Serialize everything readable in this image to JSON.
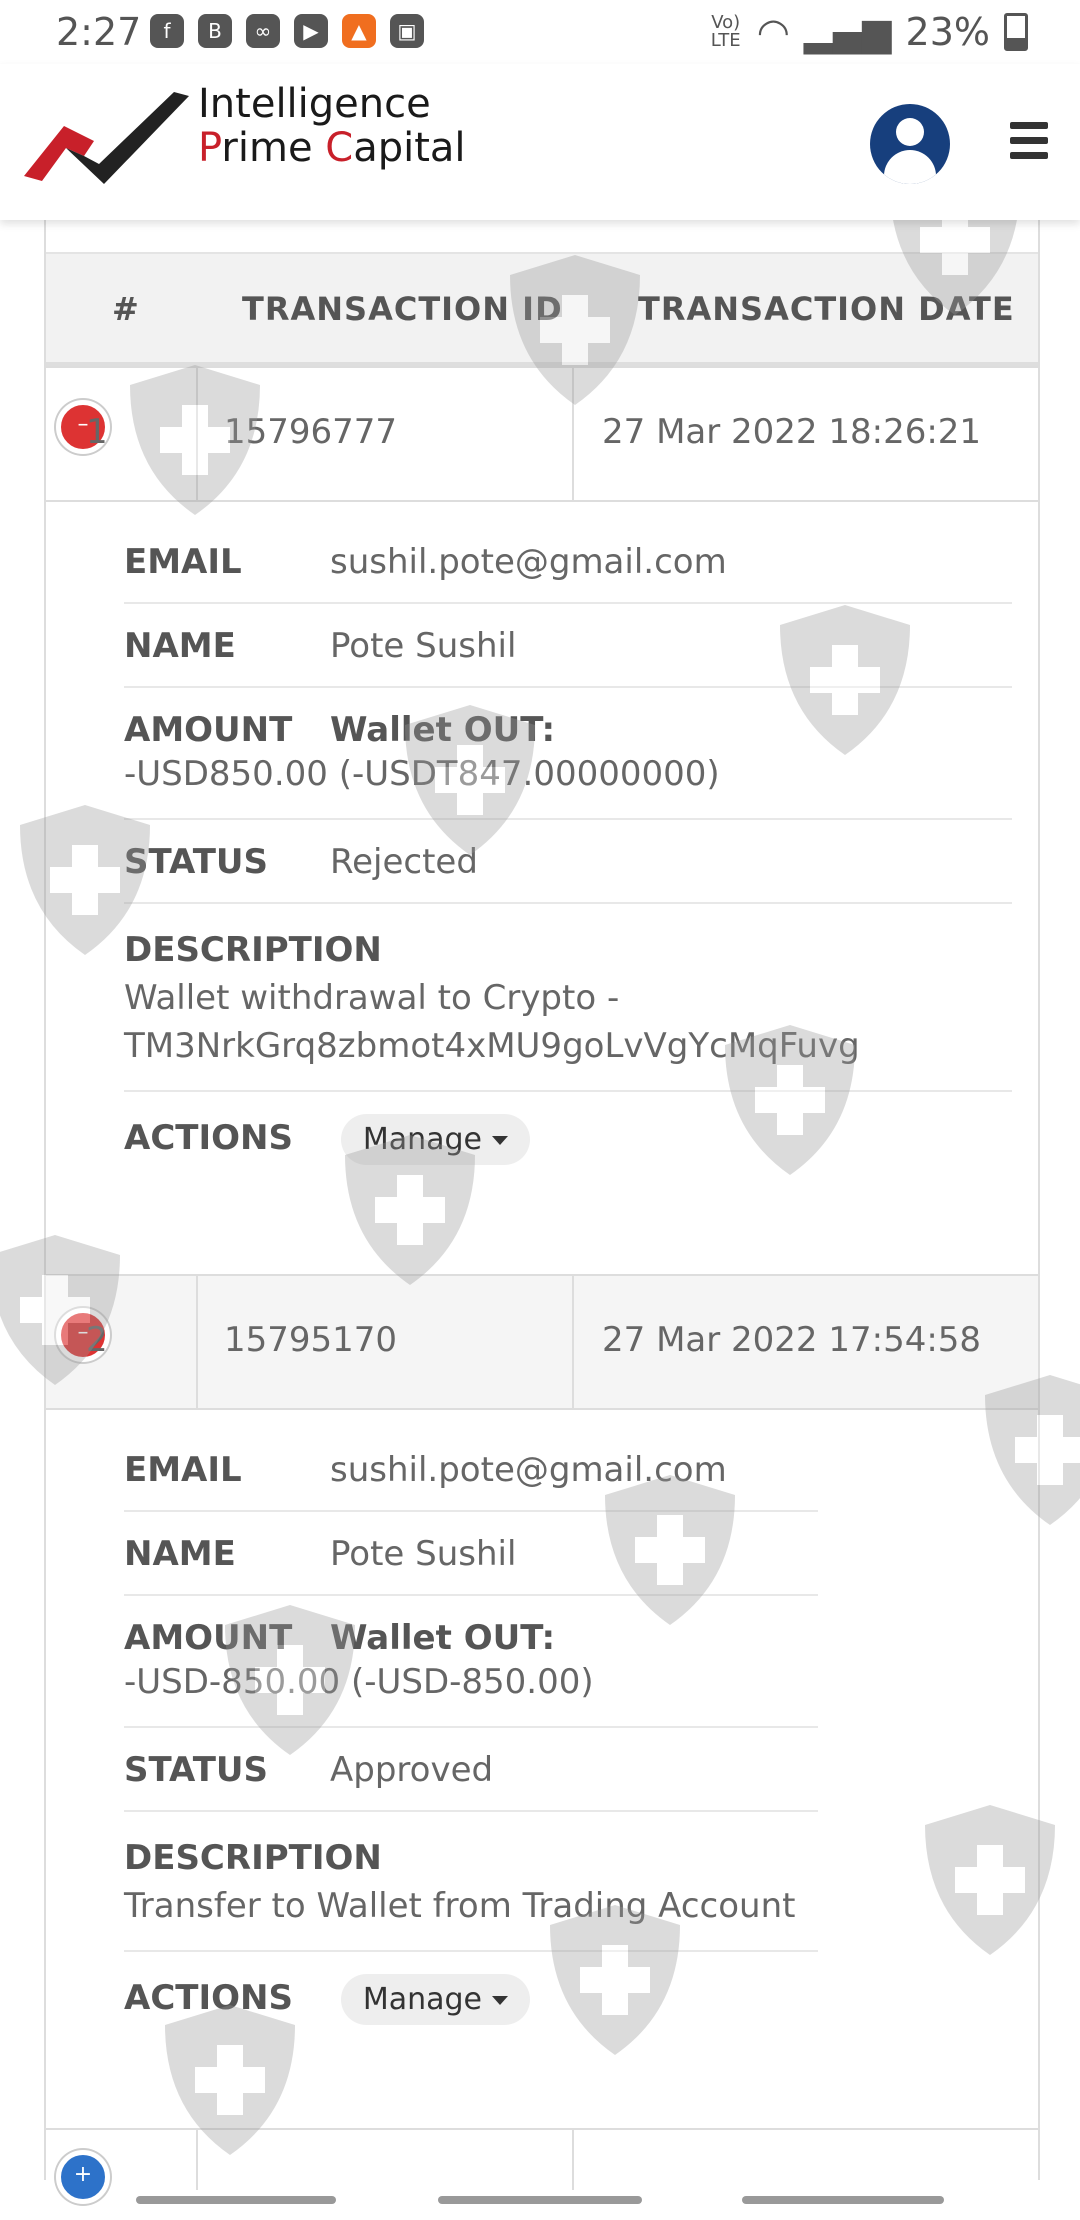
{
  "status_bar": {
    "time": "2:27",
    "network": "Vo) LTE",
    "battery": "23%",
    "icons": [
      "facebook-icon",
      "b-icon",
      "app-icon",
      "youtube-icon",
      "vlc-icon",
      "image-icon",
      "wifi-icon",
      "signal-icon",
      "battery-icon"
    ]
  },
  "header": {
    "logo_line1": "Intelligence",
    "logo_line2_p": "P",
    "logo_line2_rime": "rime ",
    "logo_line2_c": "C",
    "logo_line2_apital": "apital"
  },
  "table": {
    "headers": [
      "#",
      "TRANSACTION ID",
      "TRANSACTION DATE"
    ],
    "rows": [
      {
        "num": "1",
        "id": "15796777",
        "date": "27 Mar 2022 18:26:21",
        "email_label": "EMAIL",
        "email": "sushil.pote@gmail.com",
        "name_label": "NAME",
        "name": "Pote Sushil",
        "amount_label": "AMOUNT",
        "amount_type": "Wallet OUT:",
        "amount": "-USD850.00 (-USDT847.00000000)",
        "status_label": "STATUS",
        "status": "Rejected",
        "desc_label": "DESCRIPTION",
        "desc_line1": "Wallet withdrawal to Crypto -",
        "desc_line2": "TM3NrkGrq8zbmot4xMU9goLvVgYcMqFuvg",
        "actions_label": "ACTIONS",
        "manage": "Manage"
      },
      {
        "num": "2",
        "id": "15795170",
        "date": "27 Mar 2022 17:54:58",
        "email_label": "EMAIL",
        "email": "sushil.pote@gmail.com",
        "name_label": "NAME",
        "name": "Pote Sushil",
        "amount_label": "AMOUNT",
        "amount_type": "Wallet OUT:",
        "amount": "-USD-850.00 (-USD-850.00)",
        "status_label": "STATUS",
        "status": "Approved",
        "desc_label": "DESCRIPTION",
        "desc_line1": "Transfer to Wallet from Trading Account",
        "actions_label": "ACTIONS",
        "manage": "Manage"
      }
    ]
  }
}
